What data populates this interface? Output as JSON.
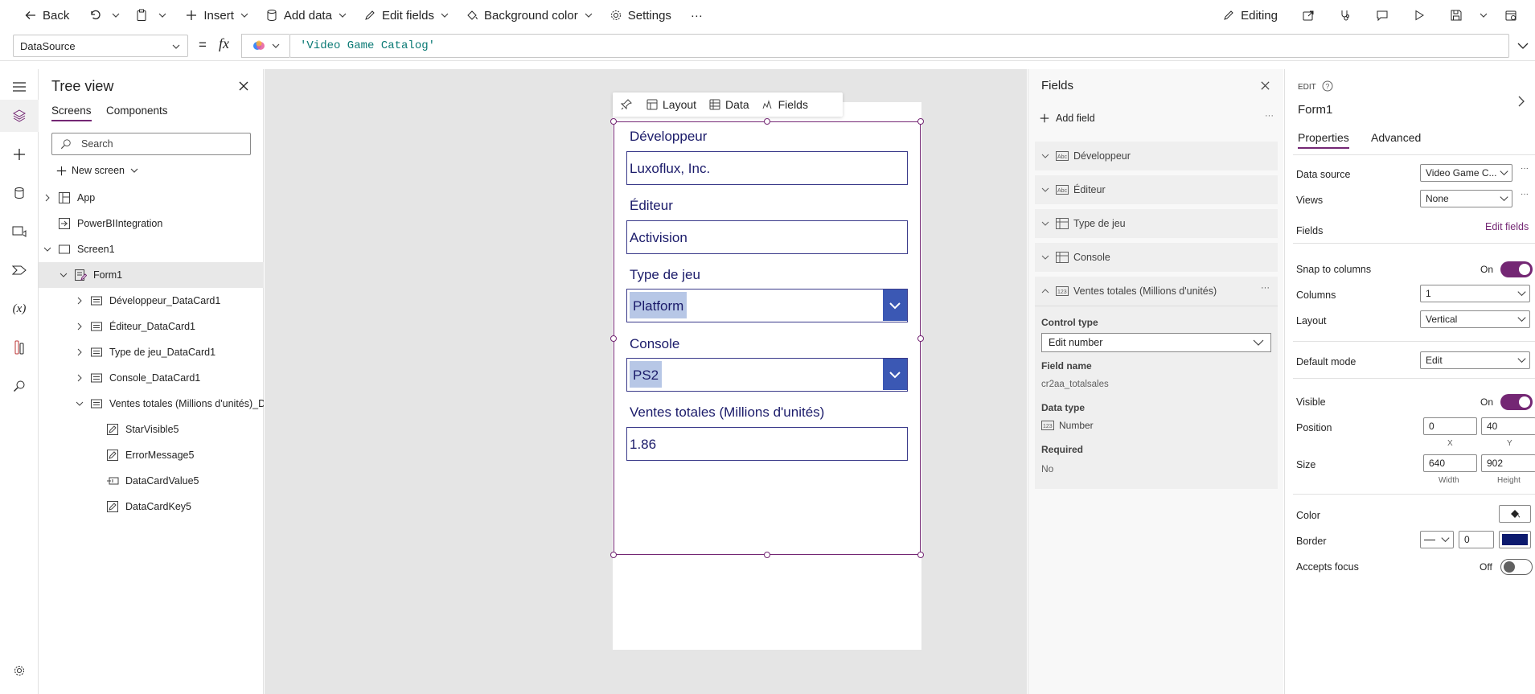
{
  "toolbar": {
    "back": "Back",
    "insert": "Insert",
    "add_data": "Add data",
    "edit_fields": "Edit fields",
    "background_color": "Background color",
    "settings": "Settings",
    "more": "···",
    "editing": "Editing"
  },
  "formula_bar": {
    "property": "DataSource",
    "eq": "=",
    "fx": "fx",
    "formula": "'Video Game Catalog'"
  },
  "tree": {
    "title": "Tree view",
    "tabs": [
      "Screens",
      "Components"
    ],
    "search_placeholder": "Search",
    "new_screen": "New screen",
    "items": [
      {
        "label": "App"
      },
      {
        "label": "PowerBIIntegration"
      },
      {
        "label": "Screen1"
      },
      {
        "label": "Form1"
      },
      {
        "label": "Développeur_DataCard1"
      },
      {
        "label": "Éditeur_DataCard1"
      },
      {
        "label": "Type de jeu_DataCard1"
      },
      {
        "label": "Console_DataCard1"
      },
      {
        "label": "Ventes totales (Millions d'unités)_Dat"
      },
      {
        "label": "StarVisible5"
      },
      {
        "label": "ErrorMessage5"
      },
      {
        "label": "DataCardValue5"
      },
      {
        "label": "DataCardKey5"
      }
    ]
  },
  "form_toolbar": {
    "layout": "Layout",
    "data": "Data",
    "fields": "Fields"
  },
  "form": {
    "developer_label": "Développeur",
    "developer_value": "Luxoflux, Inc.",
    "publisher_label": "Éditeur",
    "publisher_value": "Activision",
    "type_label": "Type de jeu",
    "type_value": "Platform",
    "console_label": "Console",
    "console_value": "PS2",
    "sales_label": "Ventes totales (Millions d'unités)",
    "sales_value": "1.86"
  },
  "fields_panel": {
    "title": "Fields",
    "add_field": "Add field",
    "more": "···",
    "fields": [
      "Développeur",
      "Éditeur",
      "Type de jeu",
      "Console",
      "Ventes totales (Millions d'unités)"
    ],
    "control_type_label": "Control type",
    "control_type_value": "Edit number",
    "field_name_label": "Field name",
    "field_name_value": "cr2aa_totalsales",
    "data_type_label": "Data type",
    "data_type_value": "Number",
    "required_label": "Required",
    "required_value": "No"
  },
  "properties": {
    "edit_label": "EDIT",
    "name": "Form1",
    "tabs": [
      "Properties",
      "Advanced"
    ],
    "data_source_label": "Data source",
    "data_source_value": "Video Game C...",
    "views_label": "Views",
    "views_value": "None",
    "fields_label": "Fields",
    "edit_fields_link": "Edit fields",
    "snap_label": "Snap to columns",
    "snap_value": "On",
    "columns_label": "Columns",
    "columns_value": "1",
    "layout_label": "Layout",
    "layout_value": "Vertical",
    "default_mode_label": "Default mode",
    "default_mode_value": "Edit",
    "visible_label": "Visible",
    "visible_value": "On",
    "position_label": "Position",
    "position_x": "0",
    "position_y": "40",
    "x_label": "X",
    "y_label": "Y",
    "size_label": "Size",
    "size_width": "640",
    "size_height": "902",
    "width_label": "Width",
    "height_label": "Height",
    "color_label": "Color",
    "border_label": "Border",
    "border_width": "0",
    "border_color": "#0c1a6e",
    "accepts_focus_label": "Accepts focus",
    "accepts_focus_value": "Off",
    "accent": "#742774"
  }
}
